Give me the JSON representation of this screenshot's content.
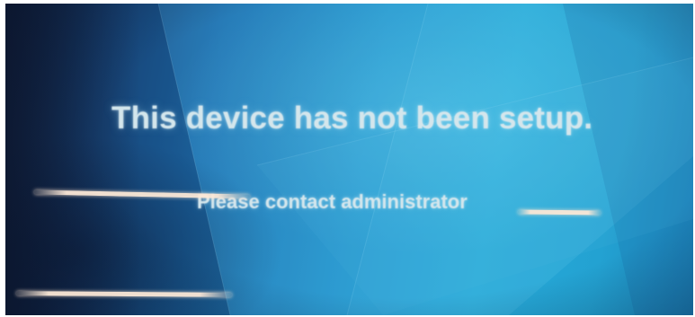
{
  "screen": {
    "title": "This device has not been setup.",
    "subtitle": "Please contact administrator"
  },
  "colors": {
    "background_deep": "#14294a",
    "background_mid": "#1f73b3",
    "background_light": "#27a9d8",
    "message_text": "#d4e6ec"
  }
}
